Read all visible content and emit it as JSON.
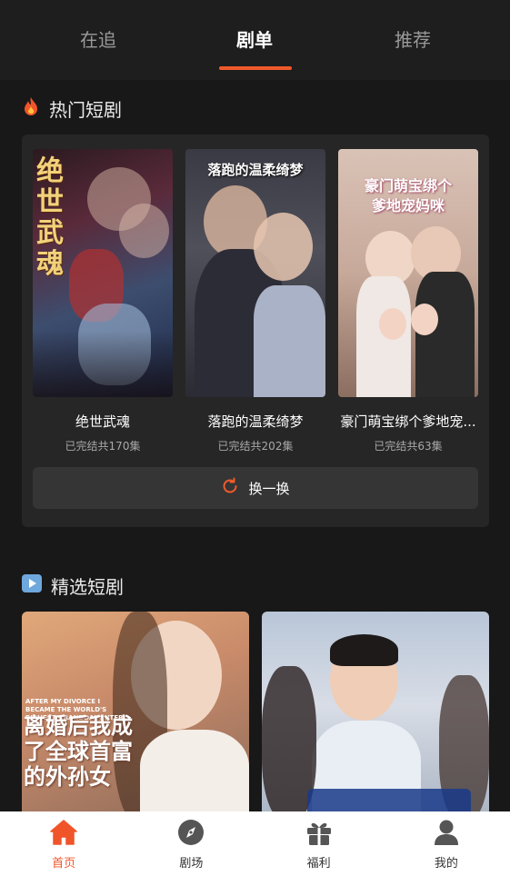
{
  "tabs": [
    {
      "label": "在追"
    },
    {
      "label": "剧单"
    },
    {
      "label": "推荐"
    }
  ],
  "hot": {
    "title": "热门短剧",
    "refresh_label": "换一换",
    "items": [
      {
        "title": "绝世武魂",
        "status": "已完结共170集",
        "poster_text": "绝世武魂"
      },
      {
        "title": "落跑的温柔绮梦",
        "status": "已完结共202集",
        "poster_text": "落跑的温柔绮梦"
      },
      {
        "title": "豪门萌宝绑个爹地宠...",
        "status": "已完结共63集",
        "poster_text": "豪门萌宝绑个爹地宠妈咪"
      }
    ]
  },
  "featured": {
    "title": "精选短剧",
    "items": [
      {
        "poster_text": "离婚后我成了全球首富的外孙女",
        "poster_text_en": "AFTER MY DIVORCE I BECAME THE WORLD'S RICHEST GRANDDAUGHTER"
      },
      {
        "poster_text": ""
      }
    ]
  },
  "nav": [
    {
      "label": "首页",
      "icon": "home-icon"
    },
    {
      "label": "剧场",
      "icon": "compass-icon"
    },
    {
      "label": "福利",
      "icon": "gift-icon"
    },
    {
      "label": "我的",
      "icon": "user-icon"
    }
  ],
  "colors": {
    "accent": "#f05a2b",
    "background": "#181818",
    "panel": "#262626"
  }
}
